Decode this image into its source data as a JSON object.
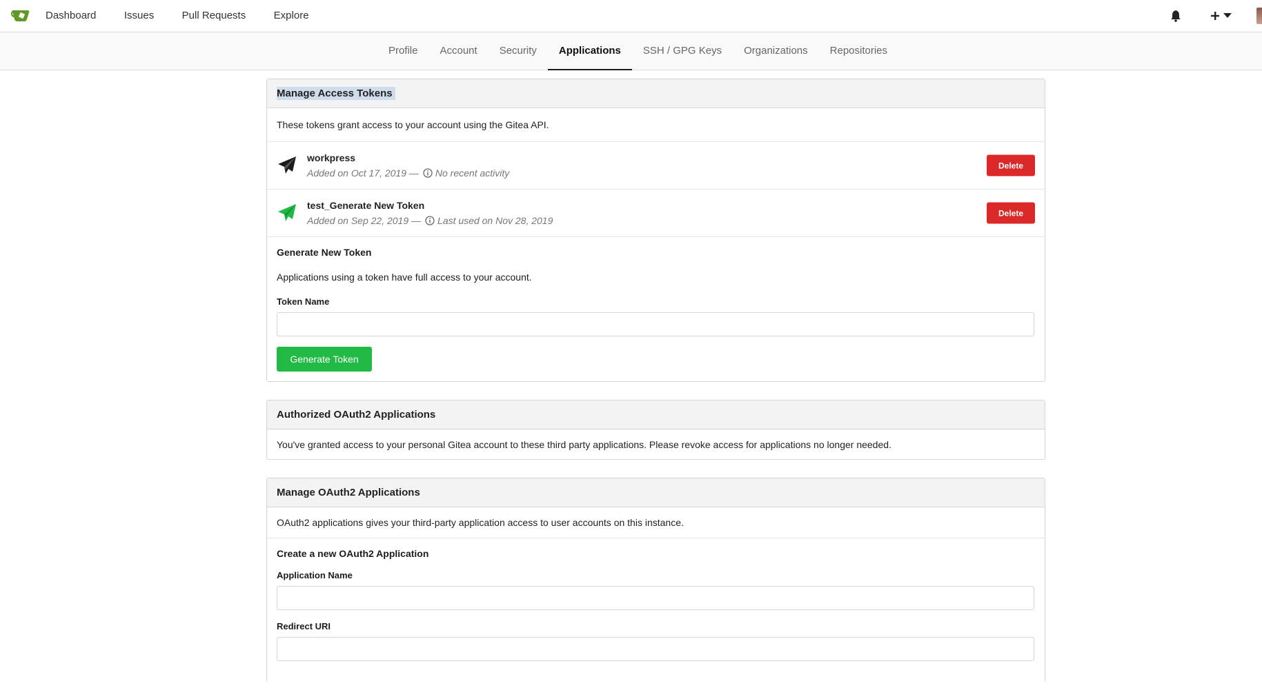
{
  "topnav": {
    "items": [
      "Dashboard",
      "Issues",
      "Pull Requests",
      "Explore"
    ],
    "colors": {
      "logo": "#609926"
    }
  },
  "tabs": {
    "items": [
      "Profile",
      "Account",
      "Security",
      "Applications",
      "SSH / GPG Keys",
      "Organizations",
      "Repositories"
    ],
    "active": "Applications"
  },
  "tokens_panel": {
    "title": "Manage Access Tokens",
    "description": "These tokens grant access to your account using the Gitea API.",
    "tokens": [
      {
        "name": "workpress",
        "added": "Added on Oct 17, 2019 —",
        "activity": "No recent activity",
        "icon_color": "#1b1c1d",
        "delete_label": "Delete"
      },
      {
        "name": "test_Generate New Token",
        "added": "Added on Sep 22, 2019 —",
        "activity": "Last used on Nov 28, 2019",
        "icon_color": "#21ba45",
        "delete_label": "Delete"
      }
    ],
    "generate": {
      "title": "Generate New Token",
      "description": "Applications using a token have full access to your account.",
      "field_label": "Token Name",
      "field_value": "",
      "button_label": "Generate Token"
    }
  },
  "oauth_authorized": {
    "title": "Authorized OAuth2 Applications",
    "description": "You've granted access to your personal Gitea account to these third party applications. Please revoke access for applications no longer needed."
  },
  "oauth_manage": {
    "title": "Manage OAuth2 Applications",
    "description": "OAuth2 applications gives your third-party application access to user accounts on this instance.",
    "create_title": "Create a new OAuth2 Application",
    "app_name_label": "Application Name",
    "app_name_value": "",
    "redirect_label": "Redirect URI",
    "redirect_value": ""
  },
  "colors": {
    "danger": "#db2828",
    "success": "#21ba45"
  }
}
